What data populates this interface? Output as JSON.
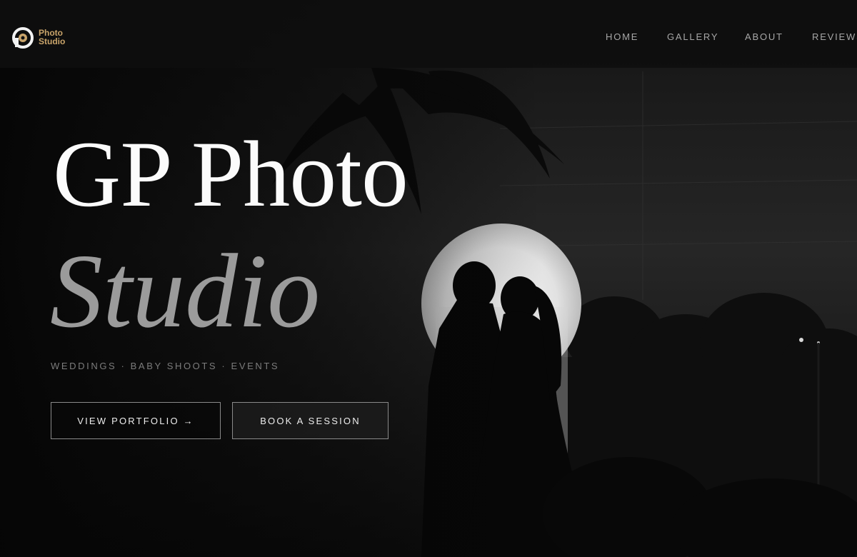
{
  "logo": {
    "line1": "Photo",
    "line2": "Studio",
    "accent": "#c9a46a",
    "icon": "camera-aperture-icon"
  },
  "nav": {
    "items": [
      {
        "label": "HOME"
      },
      {
        "label": "GALLERY"
      },
      {
        "label": "ABOUT"
      },
      {
        "label": "REVIEWS"
      }
    ]
  },
  "hero": {
    "title": "GP Photo",
    "subtitle": "Studio",
    "tagline": "WEDDINGS · BABY SHOOTS · EVENTS",
    "primary_button": "VIEW PORTFOLIO →",
    "secondary_button": "BOOK A SESSION"
  }
}
